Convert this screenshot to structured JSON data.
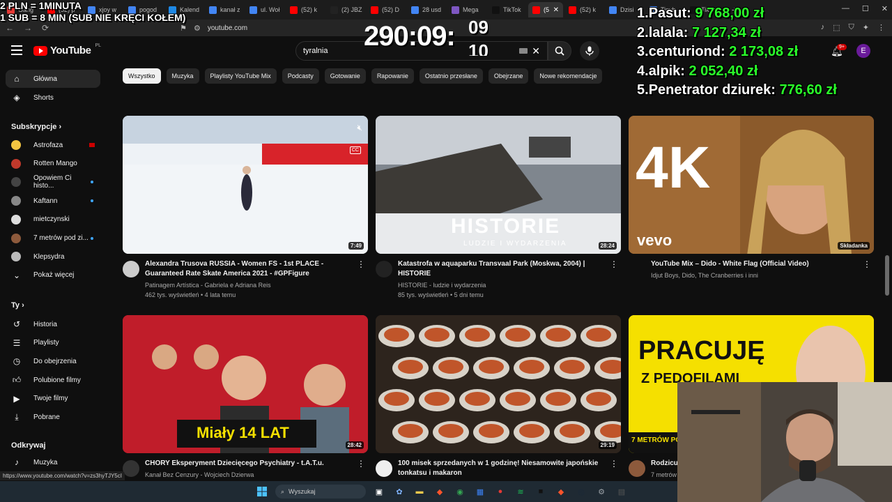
{
  "browser": {
    "tabs": [
      {
        "label": "Gang",
        "color": "#e53935"
      },
      {
        "label": "(52) p",
        "color": "#ff0000"
      },
      {
        "label": "xjoy w",
        "color": "#4285f4"
      },
      {
        "label": "pogod",
        "color": "#4285f4"
      },
      {
        "label": "Kalend",
        "color": "#1e88e5"
      },
      {
        "label": "kanał z",
        "color": "#4285f4"
      },
      {
        "label": "ul. Woł",
        "color": "#4285f4"
      },
      {
        "label": "(52) k",
        "color": "#ff0000"
      },
      {
        "label": "(2) JBZ",
        "color": "#222222"
      },
      {
        "label": "(52) D",
        "color": "#ff0000"
      },
      {
        "label": "28 usd",
        "color": "#4285f4"
      },
      {
        "label": "Mega",
        "color": "#7e57c2"
      },
      {
        "label": "TikTok",
        "color": "#111111"
      },
      {
        "label": "(5",
        "color": "#ff0000"
      },
      {
        "label": "(52) k",
        "color": "#ff0000"
      },
      {
        "label": "Dzisi",
        "color": "#4285f4"
      },
      {
        "label": "Tinyb",
        "color": "#4285f4"
      },
      {
        "label": "TikTok",
        "color": "#111111"
      }
    ],
    "active_tab_index": 13,
    "url": "youtube.com",
    "status_url": "https://www.youtube.com/watch?v=zs3hyTJY5cI"
  },
  "stream_overlay": {
    "top_left_line1": "2 PLN =  1MINUTA",
    "top_left_line2": "1 SUB = 8 MIN (SUB NIE KRĘCI KOŁEM)",
    "timer": "290:09:",
    "timer_roll_top": "09",
    "timer_roll_bottom": "10",
    "leaderboard": [
      {
        "rank": "1.",
        "name": "Pasut:",
        "amount": "9 768,00 zł"
      },
      {
        "rank": "2.",
        "name": "lalala:",
        "amount": "7 127,34 zł"
      },
      {
        "rank": "3.",
        "name": "centuriond:",
        "amount": "2 173,08 zł"
      },
      {
        "rank": "4.",
        "name": "alpik:",
        "amount": "2 052,40 zł"
      },
      {
        "rank": "5.",
        "name": "Penetrator dziurek:",
        "amount": "776,60 zł"
      }
    ]
  },
  "youtube": {
    "logo_text": "YouTube",
    "region": "PL",
    "search_value": "tyralnia",
    "notifications_badge": "9+",
    "avatar_letter": "E",
    "accent": "#ff0000"
  },
  "sidebar": {
    "main": [
      {
        "label": "Główna",
        "icon": "home-icon",
        "active": true
      },
      {
        "label": "Shorts",
        "icon": "shorts-icon",
        "active": false
      }
    ],
    "subscriptions_title": "Subskrypcje",
    "subscriptions": [
      {
        "label": "Astrofaza",
        "color": "#f4c542",
        "status": "live"
      },
      {
        "label": "Rotten Mango",
        "color": "#c0392b",
        "status": ""
      },
      {
        "label": "Opowiem Ci histo...",
        "color": "#444444",
        "status": "dot"
      },
      {
        "label": "Kaftann",
        "color": "#888888",
        "status": "dot"
      },
      {
        "label": "mietczynski",
        "color": "#dddddd",
        "status": ""
      },
      {
        "label": "7 metrów pod zi...",
        "color": "#8d5a3c",
        "status": "dot"
      },
      {
        "label": "Klepsydra",
        "color": "#bbbbbb",
        "status": ""
      }
    ],
    "show_more": "Pokaż więcej",
    "you_title": "Ty",
    "you": [
      {
        "label": "Historia",
        "icon": "history-icon"
      },
      {
        "label": "Playlisty",
        "icon": "playlist-icon"
      },
      {
        "label": "Do obejrzenia",
        "icon": "watch-later-icon"
      },
      {
        "label": "Polubione filmy",
        "icon": "like-icon"
      },
      {
        "label": "Twoje filmy",
        "icon": "your-videos-icon"
      },
      {
        "label": "Pobrane",
        "icon": "download-icon"
      }
    ],
    "explore_title": "Odkrywaj",
    "explore": [
      {
        "label": "Muzyka",
        "icon": "music-icon"
      }
    ]
  },
  "chips": [
    "Wszystko",
    "Muzyka",
    "Playlisty YouTube Mix",
    "Podcasty",
    "Gotowanie",
    "Rapowanie",
    "Ostatnio przesłane",
    "Obejrzane",
    "Nowe rekomendacje"
  ],
  "videos": [
    {
      "title": "Alexandra Trusova RUSSIA - Women FS - 1st PLACE - Guaranteed Rate Skate America 2021  - #GPFigure",
      "channel": "Patinagem Artística - Gabriela e Adriana Reis",
      "meta": "462 tys. wyświetleń • 4 lata temu",
      "duration": "7:49",
      "thumb_bg": "#dfe6ee",
      "avatar": "#cccccc"
    },
    {
      "title": "Katastrofa w aquaparku Transvaal Park (Moskwa, 2004) | HISTORIE",
      "channel": "HISTORIE - ludzie i wydarzenia",
      "meta": "85 tys. wyświetleń • 5 dni temu",
      "duration": "28:24",
      "thumb_bg": "#8a8f96",
      "avatar": "#222222",
      "thumb_text": "HISTORIE",
      "thumb_sub": "LUDZIE I WYDARZENIA"
    },
    {
      "title": "YouTube Mix – Dido - White Flag (Official Video)",
      "channel": "Idjut Boys, Dido, The Cranberries i inni",
      "meta": "",
      "duration": "Składanka",
      "thumb_bg": "#9a6a3a",
      "avatar": "",
      "thumb_text": "4K",
      "thumb_sub": "vevo"
    },
    {
      "title": "CHORY Eksperyment Dziecięcego Psychiatry - t.A.T.u.",
      "channel": "Kanał Bez Cenzury - Wojciech Dzierwa",
      "meta": "",
      "duration": "28:42",
      "thumb_bg": "#c8232c",
      "avatar": "#333333",
      "thumb_text": "Miały 14 LAT"
    },
    {
      "title": "100 misek sprzedanych w 1 godzinę! Niesamowite japońskie tonkatsu i makaron",
      "channel": "",
      "meta": "",
      "duration": "29:19",
      "thumb_bg": "#3a2a20",
      "avatar": "#eeeeee"
    },
    {
      "title": "Rodzicu",
      "channel": "7 metrów",
      "meta": "",
      "duration": "",
      "thumb_bg": "#f5e000",
      "avatar": "#8d5a3c",
      "thumb_text": "PRACUJĘ",
      "thumb_sub": "Z PEDOFILAMI",
      "thumb_strip": "7 METRÓW POD Z"
    }
  ],
  "taskbar": {
    "search_placeholder": "Wyszukaj",
    "apps": [
      {
        "name": "task-view-icon",
        "color": "#ffffff"
      },
      {
        "name": "copilot-icon",
        "color": "#7fb3ff"
      },
      {
        "name": "explorer-icon",
        "color": "#f2c94c"
      },
      {
        "name": "brave-icon",
        "color": "#fb542b"
      },
      {
        "name": "chrome-icon",
        "color": "#34a853"
      },
      {
        "name": "store-icon",
        "color": "#3b82f6"
      },
      {
        "name": "app-icon",
        "color": "#e53935"
      },
      {
        "name": "spotify-icon",
        "color": "#1db954"
      },
      {
        "name": "app2-icon",
        "color": "#111111"
      },
      {
        "name": "brave2-icon",
        "color": "#fb542b"
      },
      {
        "name": "steam-icon",
        "color": "#1b2838"
      },
      {
        "name": "settings-icon",
        "color": "#9aa0a6"
      },
      {
        "name": "calculator-icon",
        "color": "#555555"
      }
    ]
  }
}
